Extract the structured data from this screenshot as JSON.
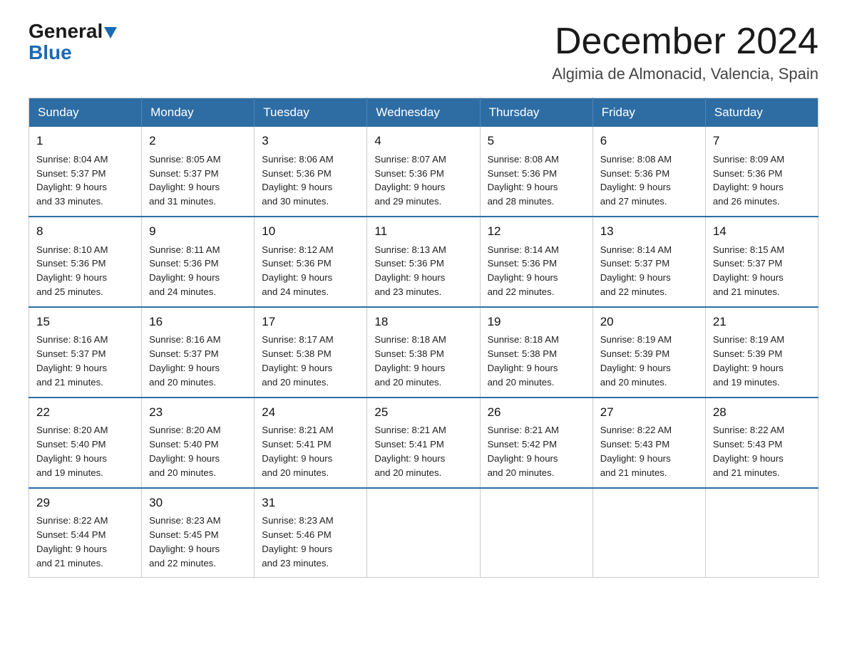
{
  "header": {
    "logo_general": "General",
    "logo_blue": "Blue",
    "month_title": "December 2024",
    "location": "Algimia de Almonacid, Valencia, Spain"
  },
  "weekdays": [
    "Sunday",
    "Monday",
    "Tuesday",
    "Wednesday",
    "Thursday",
    "Friday",
    "Saturday"
  ],
  "weeks": [
    [
      {
        "day": "1",
        "sunrise": "8:04 AM",
        "sunset": "5:37 PM",
        "daylight": "9 hours and 33 minutes."
      },
      {
        "day": "2",
        "sunrise": "8:05 AM",
        "sunset": "5:37 PM",
        "daylight": "9 hours and 31 minutes."
      },
      {
        "day": "3",
        "sunrise": "8:06 AM",
        "sunset": "5:36 PM",
        "daylight": "9 hours and 30 minutes."
      },
      {
        "day": "4",
        "sunrise": "8:07 AM",
        "sunset": "5:36 PM",
        "daylight": "9 hours and 29 minutes."
      },
      {
        "day": "5",
        "sunrise": "8:08 AM",
        "sunset": "5:36 PM",
        "daylight": "9 hours and 28 minutes."
      },
      {
        "day": "6",
        "sunrise": "8:08 AM",
        "sunset": "5:36 PM",
        "daylight": "9 hours and 27 minutes."
      },
      {
        "day": "7",
        "sunrise": "8:09 AM",
        "sunset": "5:36 PM",
        "daylight": "9 hours and 26 minutes."
      }
    ],
    [
      {
        "day": "8",
        "sunrise": "8:10 AM",
        "sunset": "5:36 PM",
        "daylight": "9 hours and 25 minutes."
      },
      {
        "day": "9",
        "sunrise": "8:11 AM",
        "sunset": "5:36 PM",
        "daylight": "9 hours and 24 minutes."
      },
      {
        "day": "10",
        "sunrise": "8:12 AM",
        "sunset": "5:36 PM",
        "daylight": "9 hours and 24 minutes."
      },
      {
        "day": "11",
        "sunrise": "8:13 AM",
        "sunset": "5:36 PM",
        "daylight": "9 hours and 23 minutes."
      },
      {
        "day": "12",
        "sunrise": "8:14 AM",
        "sunset": "5:36 PM",
        "daylight": "9 hours and 22 minutes."
      },
      {
        "day": "13",
        "sunrise": "8:14 AM",
        "sunset": "5:37 PM",
        "daylight": "9 hours and 22 minutes."
      },
      {
        "day": "14",
        "sunrise": "8:15 AM",
        "sunset": "5:37 PM",
        "daylight": "9 hours and 21 minutes."
      }
    ],
    [
      {
        "day": "15",
        "sunrise": "8:16 AM",
        "sunset": "5:37 PM",
        "daylight": "9 hours and 21 minutes."
      },
      {
        "day": "16",
        "sunrise": "8:16 AM",
        "sunset": "5:37 PM",
        "daylight": "9 hours and 20 minutes."
      },
      {
        "day": "17",
        "sunrise": "8:17 AM",
        "sunset": "5:38 PM",
        "daylight": "9 hours and 20 minutes."
      },
      {
        "day": "18",
        "sunrise": "8:18 AM",
        "sunset": "5:38 PM",
        "daylight": "9 hours and 20 minutes."
      },
      {
        "day": "19",
        "sunrise": "8:18 AM",
        "sunset": "5:38 PM",
        "daylight": "9 hours and 20 minutes."
      },
      {
        "day": "20",
        "sunrise": "8:19 AM",
        "sunset": "5:39 PM",
        "daylight": "9 hours and 20 minutes."
      },
      {
        "day": "21",
        "sunrise": "8:19 AM",
        "sunset": "5:39 PM",
        "daylight": "9 hours and 19 minutes."
      }
    ],
    [
      {
        "day": "22",
        "sunrise": "8:20 AM",
        "sunset": "5:40 PM",
        "daylight": "9 hours and 19 minutes."
      },
      {
        "day": "23",
        "sunrise": "8:20 AM",
        "sunset": "5:40 PM",
        "daylight": "9 hours and 20 minutes."
      },
      {
        "day": "24",
        "sunrise": "8:21 AM",
        "sunset": "5:41 PM",
        "daylight": "9 hours and 20 minutes."
      },
      {
        "day": "25",
        "sunrise": "8:21 AM",
        "sunset": "5:41 PM",
        "daylight": "9 hours and 20 minutes."
      },
      {
        "day": "26",
        "sunrise": "8:21 AM",
        "sunset": "5:42 PM",
        "daylight": "9 hours and 20 minutes."
      },
      {
        "day": "27",
        "sunrise": "8:22 AM",
        "sunset": "5:43 PM",
        "daylight": "9 hours and 21 minutes."
      },
      {
        "day": "28",
        "sunrise": "8:22 AM",
        "sunset": "5:43 PM",
        "daylight": "9 hours and 21 minutes."
      }
    ],
    [
      {
        "day": "29",
        "sunrise": "8:22 AM",
        "sunset": "5:44 PM",
        "daylight": "9 hours and 21 minutes."
      },
      {
        "day": "30",
        "sunrise": "8:23 AM",
        "sunset": "5:45 PM",
        "daylight": "9 hours and 22 minutes."
      },
      {
        "day": "31",
        "sunrise": "8:23 AM",
        "sunset": "5:46 PM",
        "daylight": "9 hours and 23 minutes."
      },
      null,
      null,
      null,
      null
    ]
  ],
  "labels": {
    "sunrise": "Sunrise:",
    "sunset": "Sunset:",
    "daylight": "Daylight:"
  }
}
